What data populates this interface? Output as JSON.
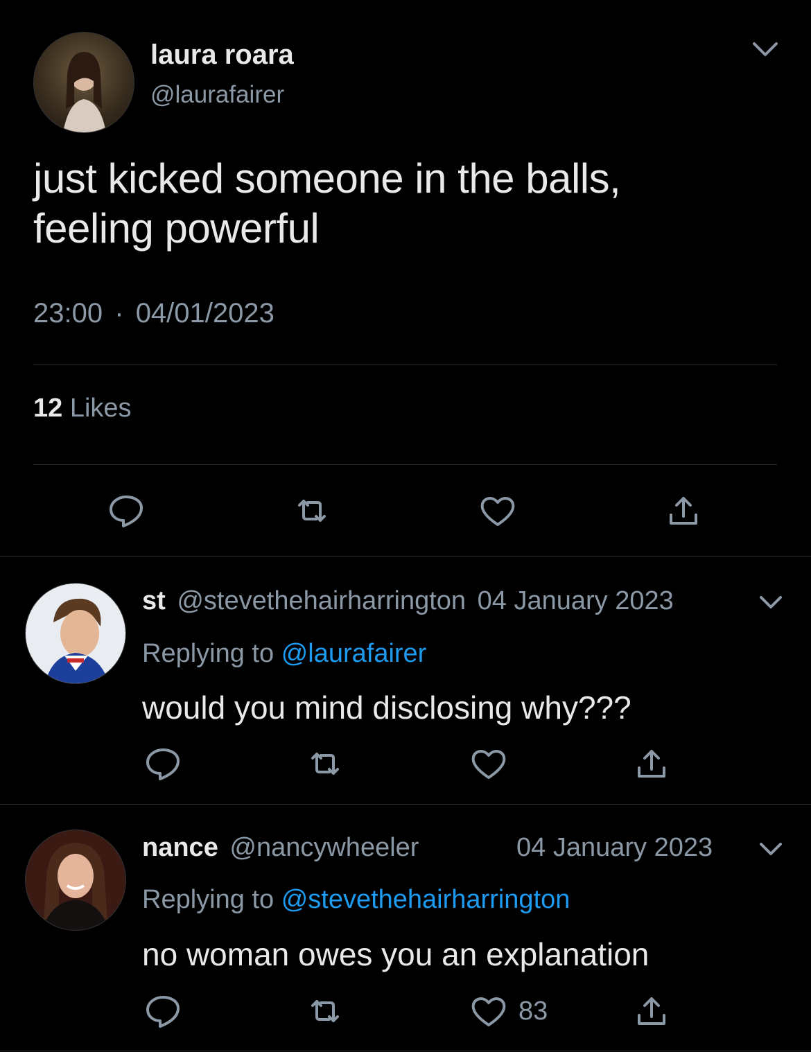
{
  "main_tweet": {
    "display_name": "laura roara",
    "handle": "@laurafairer",
    "text_line1": "just kicked someone in the balls,",
    "text_line2": "feeling powerful",
    "time": "23:00",
    "separator": "·",
    "date": "04/01/2023",
    "likes_count": "12",
    "likes_label": "Likes"
  },
  "replies": [
    {
      "display_name": "st",
      "handle": "@stevethehairharrington",
      "date": "04 January 2023",
      "replying_prefix": "Replying to",
      "replying_to": "@laurafairer",
      "text": "would you mind disclosing why???"
    },
    {
      "display_name": "nance",
      "handle": "@nancywheeler",
      "date": "04 January 2023",
      "replying_prefix": "Replying to",
      "replying_to": "@stevethehairharrington",
      "text": "no woman owes you an explanation",
      "like_count": "83"
    }
  ],
  "icons": [
    "reply-icon",
    "retweet-icon",
    "like-icon",
    "share-icon",
    "chevron-down-icon"
  ],
  "colors": {
    "background": "#000000",
    "text": "#e7e9ea",
    "muted": "#8b98a5",
    "link": "#1d9bf0",
    "divider": "#2f3336"
  }
}
